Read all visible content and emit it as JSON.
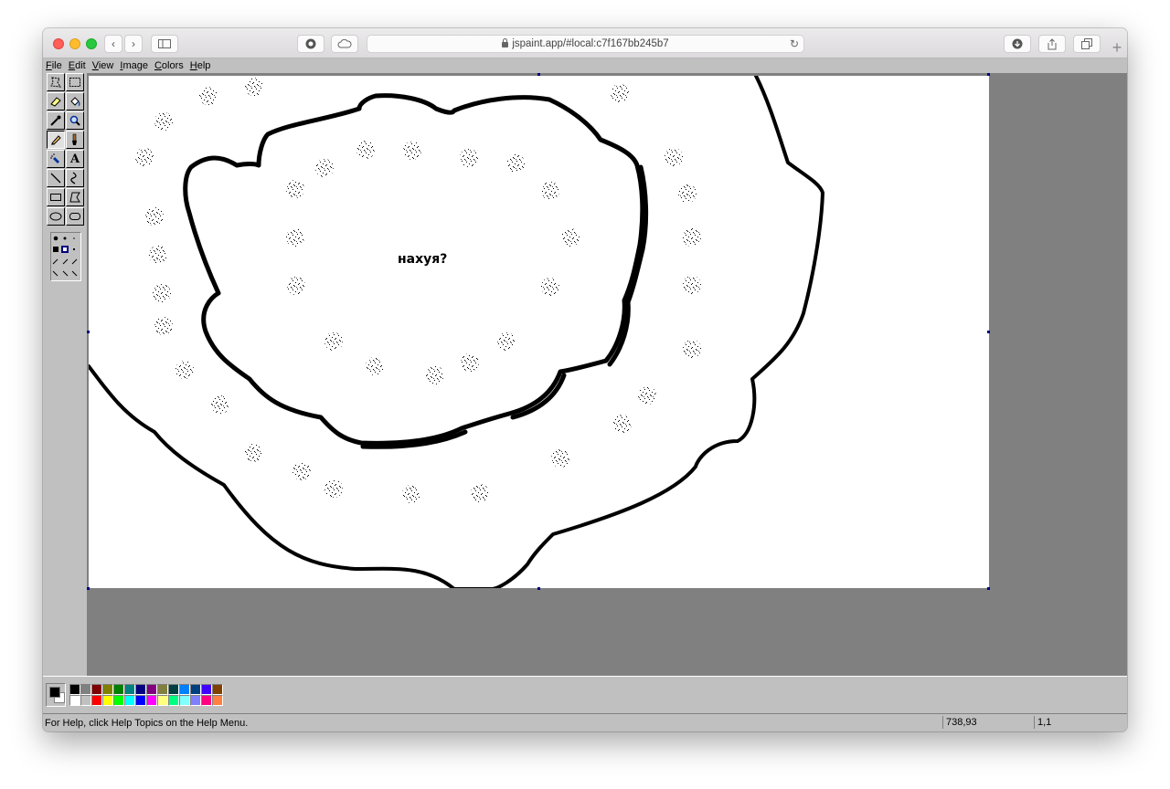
{
  "browser": {
    "url": "jspaint.app/#local:c7f167bb245b7",
    "back_icon": "chevron-left-icon",
    "forward_icon": "chevron-right-icon",
    "new_tab": "+"
  },
  "menu": [
    "File",
    "Edit",
    "View",
    "Image",
    "Colors",
    "Help"
  ],
  "canvas": {
    "text": "нахуя?"
  },
  "palette": {
    "foreground": "#000000",
    "background": "#ffffff",
    "row1": [
      "#000000",
      "#808080",
      "#800000",
      "#808000",
      "#008000",
      "#008080",
      "#000080",
      "#800080",
      "#808040",
      "#004040",
      "#0080ff",
      "#004080",
      "#4000ff",
      "#804000"
    ],
    "row2": [
      "#ffffff",
      "#c0c0c0",
      "#ff0000",
      "#ffff00",
      "#00ff00",
      "#00ffff",
      "#0000ff",
      "#ff00ff",
      "#ffff80",
      "#00ff80",
      "#80ffff",
      "#8080ff",
      "#ff0080",
      "#ff8040"
    ]
  },
  "status": {
    "help": "For Help, click Help Topics on the Help Menu.",
    "position": "738,93",
    "size": "1,1"
  }
}
